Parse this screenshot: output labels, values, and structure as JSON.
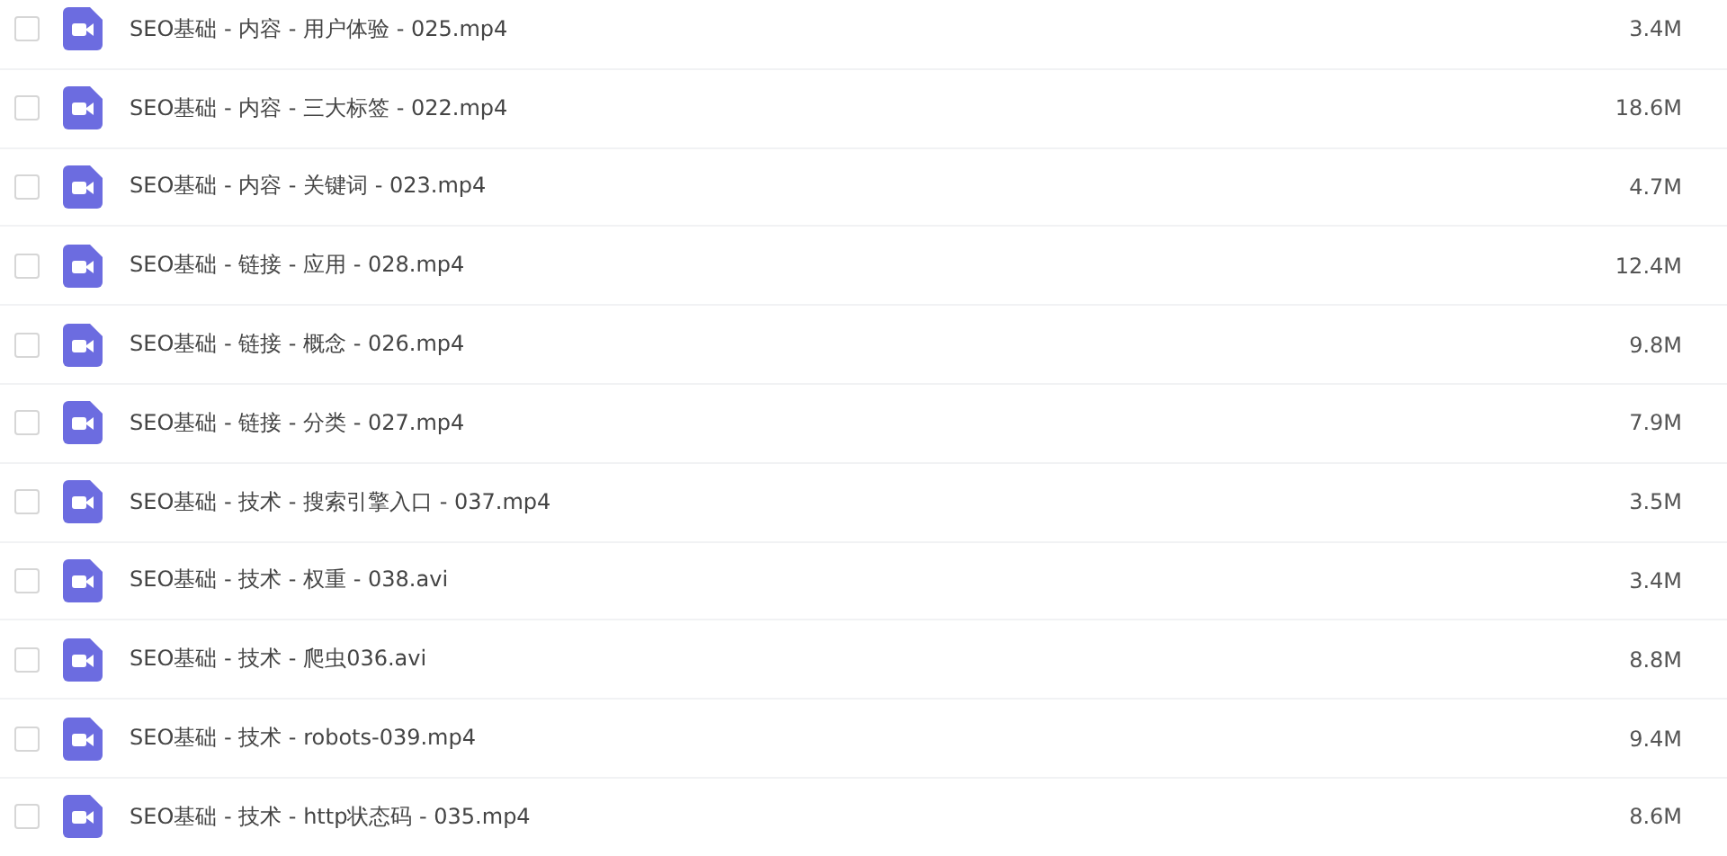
{
  "files": [
    {
      "name": "SEO基础 - 内容 - 用户体验 - 025.mp4",
      "size": "3.4M",
      "checked": false
    },
    {
      "name": "SEO基础 - 内容 - 三大标签 - 022.mp4",
      "size": "18.6M",
      "checked": false
    },
    {
      "name": "SEO基础 - 内容 - 关键词 - 023.mp4",
      "size": "4.7M",
      "checked": false
    },
    {
      "name": "SEO基础 - 链接 - 应用 - 028.mp4",
      "size": "12.4M",
      "checked": false
    },
    {
      "name": "SEO基础 - 链接 - 概念 - 026.mp4",
      "size": "9.8M",
      "checked": false
    },
    {
      "name": "SEO基础 - 链接 - 分类 - 027.mp4",
      "size": "7.9M",
      "checked": false
    },
    {
      "name": "SEO基础 - 技术 - 搜索引擎入口 - 037.mp4",
      "size": "3.5M",
      "checked": false
    },
    {
      "name": "SEO基础 - 技术 - 权重 - 038.avi",
      "size": "3.4M",
      "checked": false
    },
    {
      "name": "SEO基础 - 技术 - 爬虫036.avi",
      "size": "8.8M",
      "checked": false
    },
    {
      "name": "SEO基础 - 技术 - robots-039.mp4",
      "size": "9.4M",
      "checked": false
    },
    {
      "name": "SEO基础 - 技术 - http状态码 - 035.mp4",
      "size": "8.6M",
      "checked": false
    }
  ]
}
